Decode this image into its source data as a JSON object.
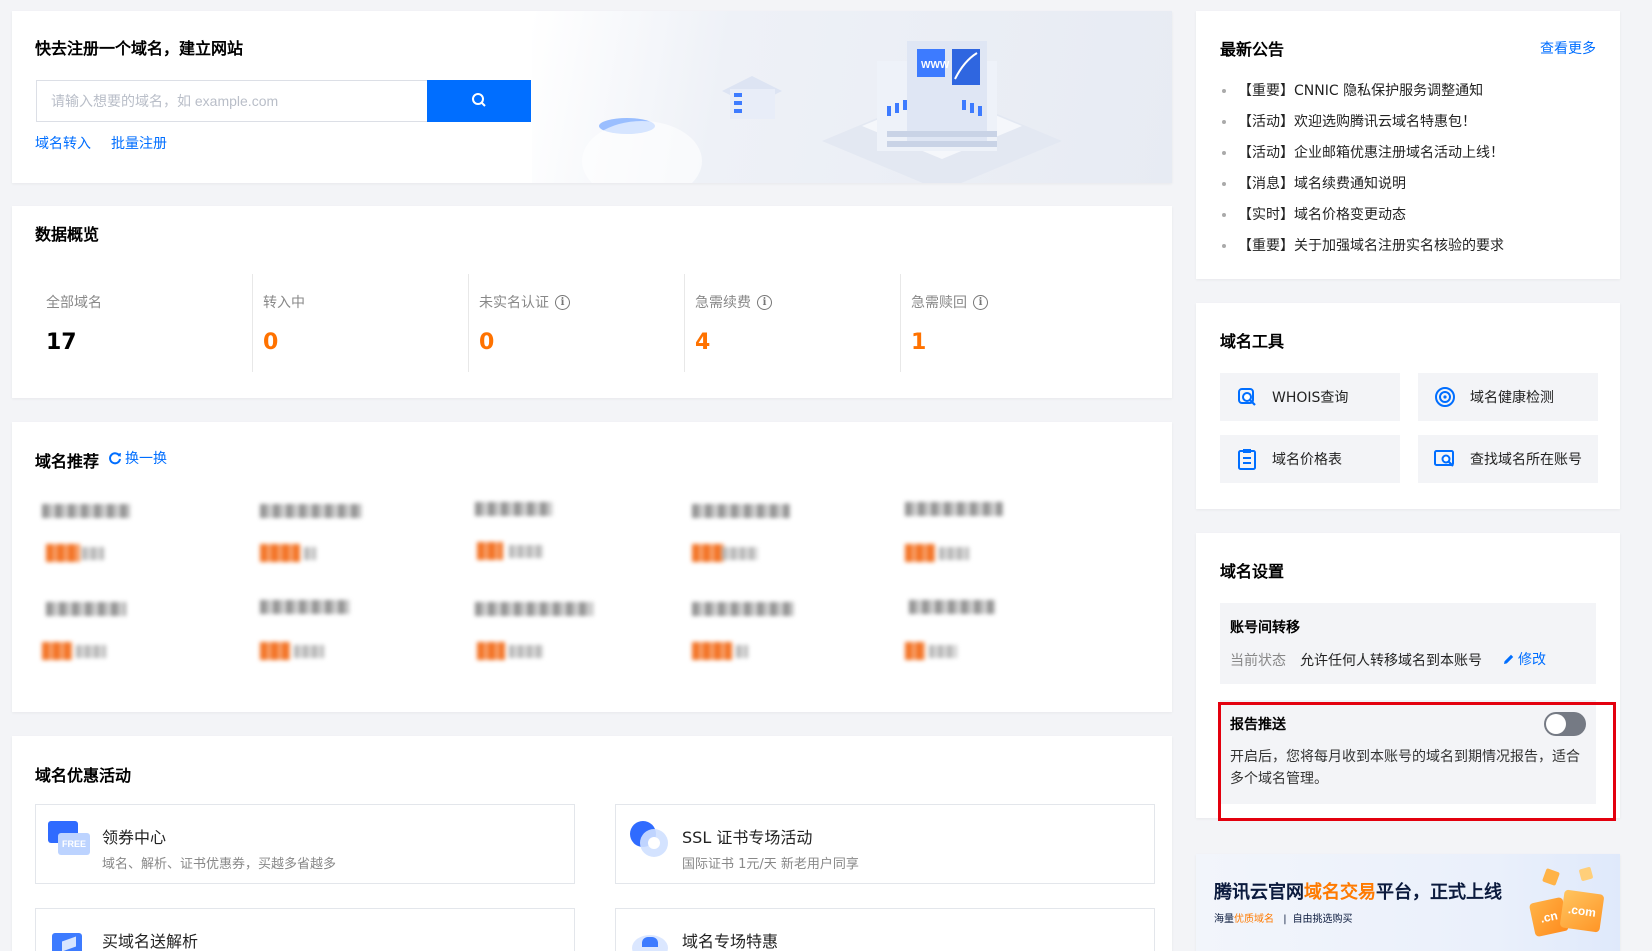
{
  "register": {
    "title": "快去注册一个域名，建立网站",
    "placeholder": "请输入想要的域名，如 example.com",
    "transfer_link": "域名转入",
    "bulk_link": "批量注册"
  },
  "overview": {
    "title": "数据概览",
    "stats": [
      {
        "label": "全部域名",
        "value": "17",
        "info": false
      },
      {
        "label": "转入中",
        "value": "0",
        "info": false
      },
      {
        "label": "未实名认证",
        "value": "0",
        "info": true
      },
      {
        "label": "急需续费",
        "value": "4",
        "info": true
      },
      {
        "label": "急需赎回",
        "value": "1",
        "info": true
      }
    ],
    "colors": {
      "total": "#000000",
      "accent": "#ff7200"
    }
  },
  "recommend": {
    "title": "域名推荐",
    "refresh_label": "换一换"
  },
  "promo": {
    "title": "域名优惠活动",
    "items": [
      {
        "title": "领券中心",
        "subtitle": "域名、解析、证书优惠券，买越多省越多",
        "icon": "coupon-icon"
      },
      {
        "title": "SSL 证书专场活动",
        "subtitle": "国际证书 1元/天 新老用户同享",
        "icon": "ssl-icon"
      },
      {
        "title": "买域名送解析",
        "subtitle": "",
        "icon": "dns-icon"
      },
      {
        "title": "域名专场特惠",
        "subtitle": "",
        "icon": "special-icon"
      }
    ]
  },
  "notice": {
    "title": "最新公告",
    "more": "查看更多",
    "items": [
      "【重要】CNNIC 隐私保护服务调整通知",
      "【活动】欢迎选购腾讯云域名特惠包！",
      "【活动】企业邮箱优惠注册域名活动上线！",
      "【消息】域名续费通知说明",
      "【实时】域名价格变更动态",
      "【重要】关于加强域名注册实名核验的要求"
    ]
  },
  "tools": {
    "title": "域名工具",
    "items": [
      {
        "label": "WHOIS查询",
        "icon": "whois-search-icon"
      },
      {
        "label": "域名健康检测",
        "icon": "health-check-icon"
      },
      {
        "label": "域名价格表",
        "icon": "price-list-icon"
      },
      {
        "label": "查找域名所在账号",
        "icon": "find-account-icon"
      }
    ]
  },
  "settings": {
    "title": "域名设置",
    "transfer": {
      "title": "账号间转移",
      "status_label": "当前状态",
      "status_value": "允许任何人转移域名到本账号",
      "edit": "修改"
    },
    "report": {
      "title": "报告推送",
      "desc_line1": "开启后，您将每月收到本账号的域名到期情况报告，适合",
      "desc_line2": "多个域名管理。",
      "enabled": false
    }
  },
  "banner": {
    "title_a": "腾讯云官网",
    "title_b": "域名交易",
    "title_c": "平台，正式上线",
    "sub_a": "海量",
    "sub_b": "优质域名",
    "sub_c": "自由挑选购买",
    "sep": "|",
    "badge_cn": ".cn",
    "badge_com": ".com"
  },
  "accent_color": "#006eff",
  "highlight_color": "#e3000e"
}
